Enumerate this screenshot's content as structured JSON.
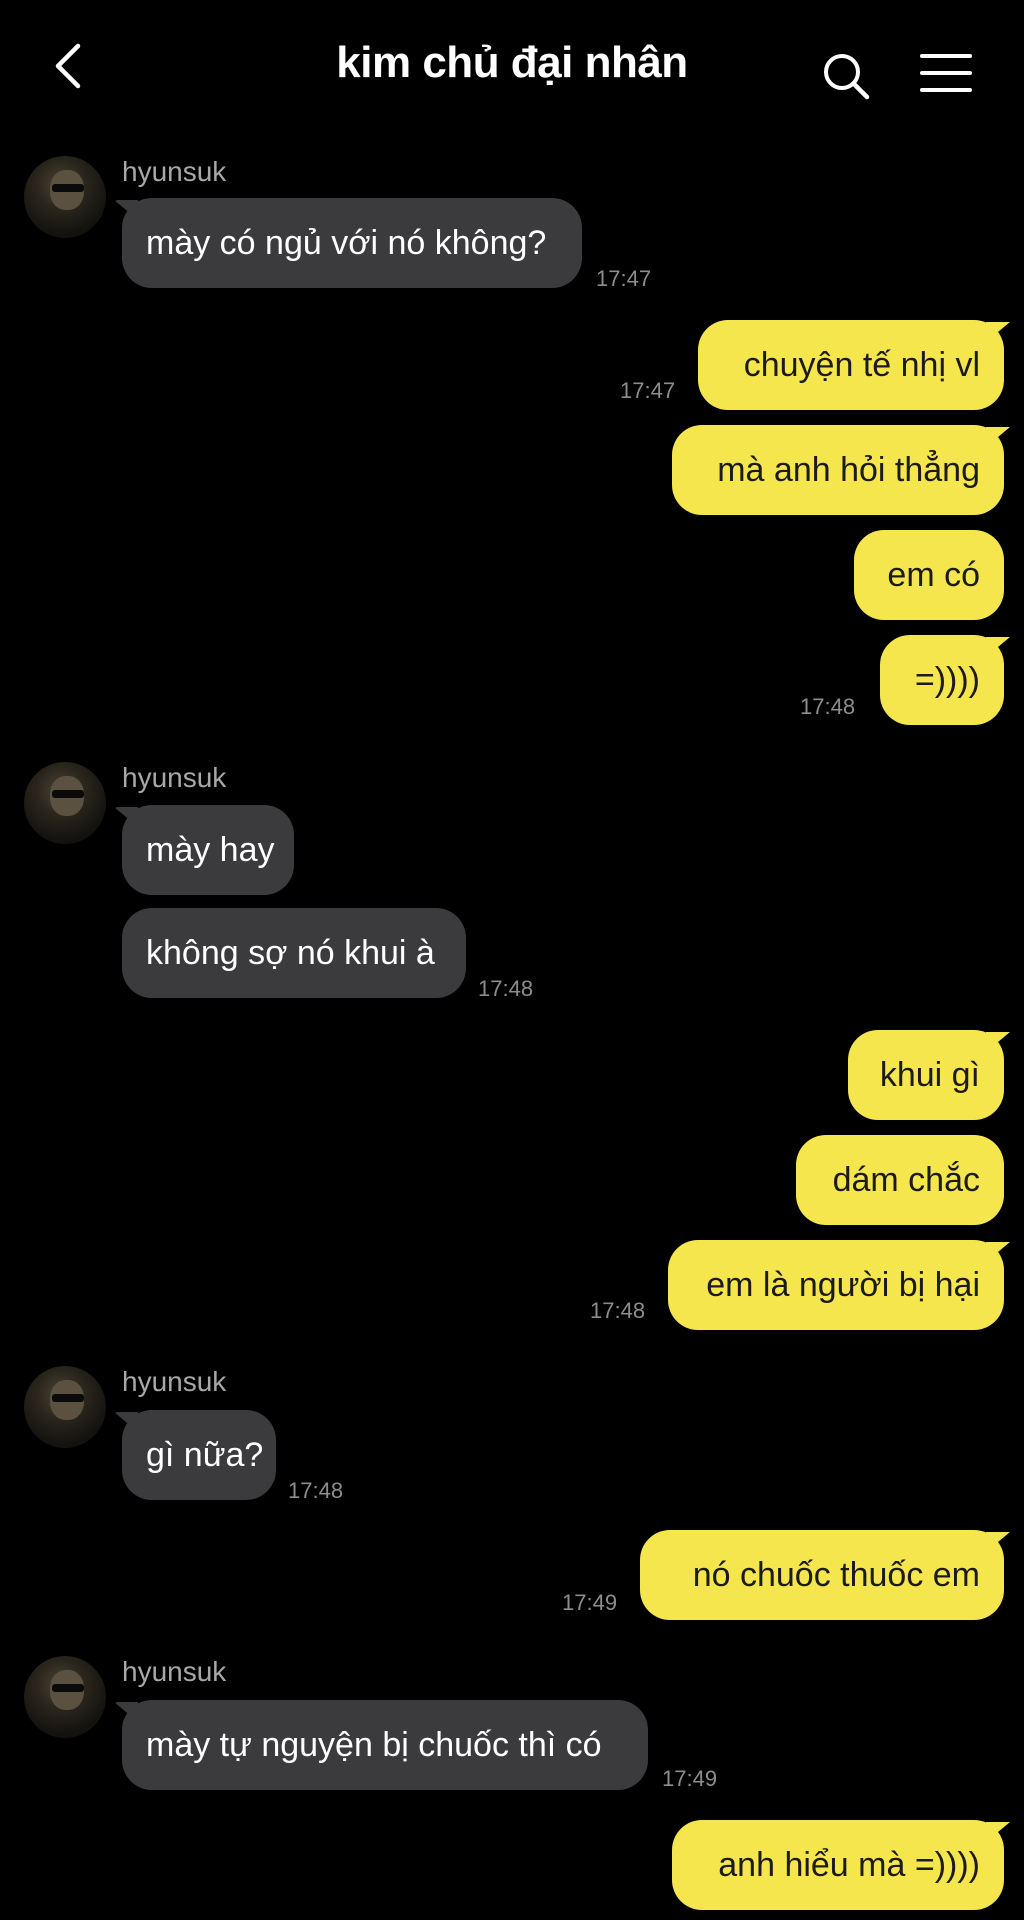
{
  "header": {
    "title": "kim chủ đại nhân",
    "back_icon": "chevron-left-icon",
    "search_icon": "search-icon",
    "menu_icon": "menu-icon"
  },
  "colors": {
    "background": "#000000",
    "incoming_bubble": "#3b3b3d",
    "outgoing_bubble": "#f6e64e",
    "timestamp": "#8d8d8d"
  },
  "messages": {
    "g1": {
      "sender": "hyunsuk",
      "m1": "mày có ngủ với nó không?",
      "time": "17:47"
    },
    "g2": {
      "m1": "chuyện tế nhị vl",
      "time": "17:47",
      "m2": "mà anh hỏi thẳng",
      "m3": "em có",
      "m4": "=))))",
      "time2": "17:48"
    },
    "g3": {
      "sender": "hyunsuk",
      "m1": "mày hay",
      "m2": "không sợ nó khui à",
      "time": "17:48"
    },
    "g4": {
      "m1": "khui gì",
      "m2": "dám chắc",
      "m3": "em là người bị hại",
      "time": "17:48"
    },
    "g5": {
      "sender": "hyunsuk",
      "m1": "gì nữa?",
      "time": "17:48"
    },
    "g6": {
      "m1": "nó chuốc thuốc em",
      "time": "17:49"
    },
    "g7": {
      "sender": "hyunsuk",
      "m1": "mày tự nguyện bị chuốc thì có",
      "time": "17:49"
    },
    "g8": {
      "m1": "anh hiểu mà =))))"
    }
  }
}
